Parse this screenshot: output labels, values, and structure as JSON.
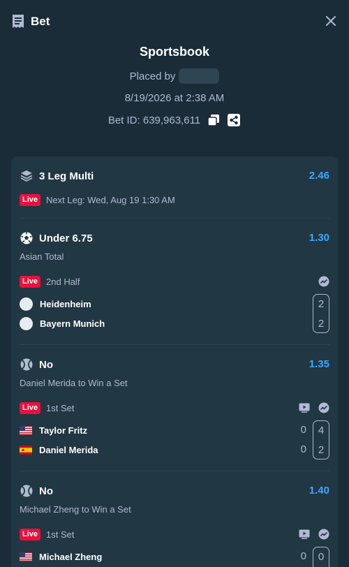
{
  "header": {
    "title": "Bet"
  },
  "summary": {
    "source": "Sportsbook",
    "placed_by_label": "Placed by",
    "date": "8/19/2026 at 2:38 AM",
    "bet_id": "Bet ID: 639,963,611"
  },
  "multi": {
    "title": "3 Leg Multi",
    "odds": "2.46",
    "live_label": "Live",
    "next_leg": "Next Leg: Wed, Aug 19 1:30 AM"
  },
  "legs": [
    {
      "selection": "Under 6.75",
      "odds": "1.30",
      "market": "Asian Total",
      "live_label": "Live",
      "period": "2nd Half",
      "team1": "Heidenheim",
      "team2": "Bayern Munich",
      "score1": "2",
      "score2": "2"
    },
    {
      "selection": "No",
      "odds": "1.35",
      "market": "Daniel Merida to Win a Set",
      "live_label": "Live",
      "period": "1st Set",
      "team1": "Taylor Fritz",
      "team2": "Daniel Merida",
      "sets1": "0",
      "sets2": "0",
      "score1": "4",
      "score2": "2"
    },
    {
      "selection": "No",
      "odds": "1.40",
      "market": "Michael Zheng to Win a Set",
      "live_label": "Live",
      "period": "1st Set",
      "team1": "Michael Zheng",
      "sets1": "0",
      "score1": "0"
    }
  ],
  "colors": {
    "background": "#1a2c38",
    "card": "#213743",
    "odds": "#3ea6ff",
    "live_badge": "#e9113c",
    "muted_text": "#b1bad3"
  }
}
